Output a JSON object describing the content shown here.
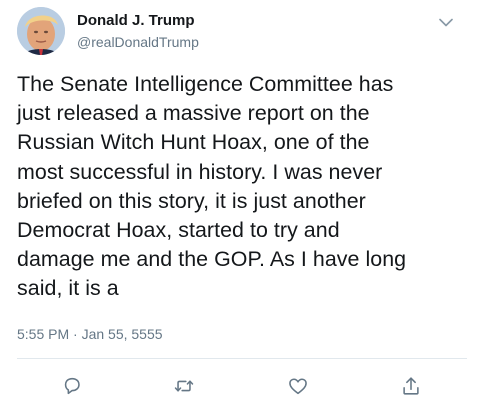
{
  "user": {
    "name": "Donald J. Trump",
    "handle": "@realDonaldTrump"
  },
  "tweet": {
    "lines": [
      "The Senate Intelligence Committee has",
      "just released a massive report on the",
      "Russian Witch Hunt Hoax, one of the",
      "most successful in history. I was never",
      "briefed on this story, it is just another",
      "Democrat Hoax, started to try and",
      "damage me and the GOP. As I have long",
      "said, it is a"
    ],
    "timestamp": "5:55 PM · Jan 55, 5555"
  },
  "icons": {
    "menu": "chevron-down-icon",
    "reply": "reply-icon",
    "retweet": "retweet-icon",
    "like": "heart-icon",
    "share": "share-icon"
  },
  "colors": {
    "text": "#14171a",
    "secondary": "#657786",
    "divider": "#e1e8ed"
  }
}
